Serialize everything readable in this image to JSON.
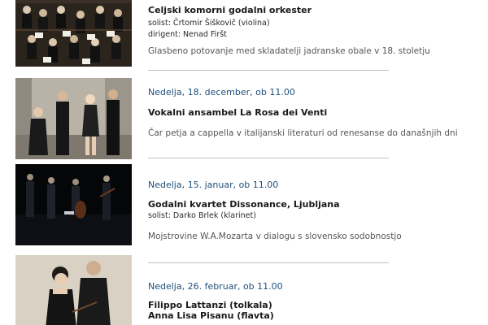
{
  "events": [
    {
      "photo_icon": "orchestra-photo",
      "date": "",
      "title": "Celjski komorni godalni orkester",
      "soloist": "solist: Črtomir Šiškovič (violina)",
      "conductor": "dirigent: Nenad Firšt",
      "description": "Glasbeno potovanje med skladatelji jadranske obale v 18. stoletju"
    },
    {
      "photo_icon": "vocal-ensemble-photo",
      "date": "Nedelja, 18. december, ob 11.00",
      "title": "Vokalni ansambel La Rosa dei Venti",
      "description": "Čar petja a cappella v italijanski literaturi od renesanse do današnjih dni"
    },
    {
      "photo_icon": "string-quartet-photo",
      "date": "Nedelja, 15. januar, ob 11.00",
      "title": "Godalni kvartet Dissonance, Ljubljana",
      "soloist": "solist: Darko Brlek (klarinet)",
      "description": "Mojstrovine W.A.Mozarta v dialogu s slovensko sodobnostjo"
    },
    {
      "photo_icon": "duo-photo",
      "date": "Nedelja, 26. februar, ob 11.00",
      "title_line1": "Filippo Lattanzi (tolkala)",
      "title_line2": "Anna Lisa Pisanu (flavta)"
    }
  ],
  "colors": {
    "date": "#1e4e7a",
    "divider": "#b9c2cc",
    "description": "#555555"
  }
}
